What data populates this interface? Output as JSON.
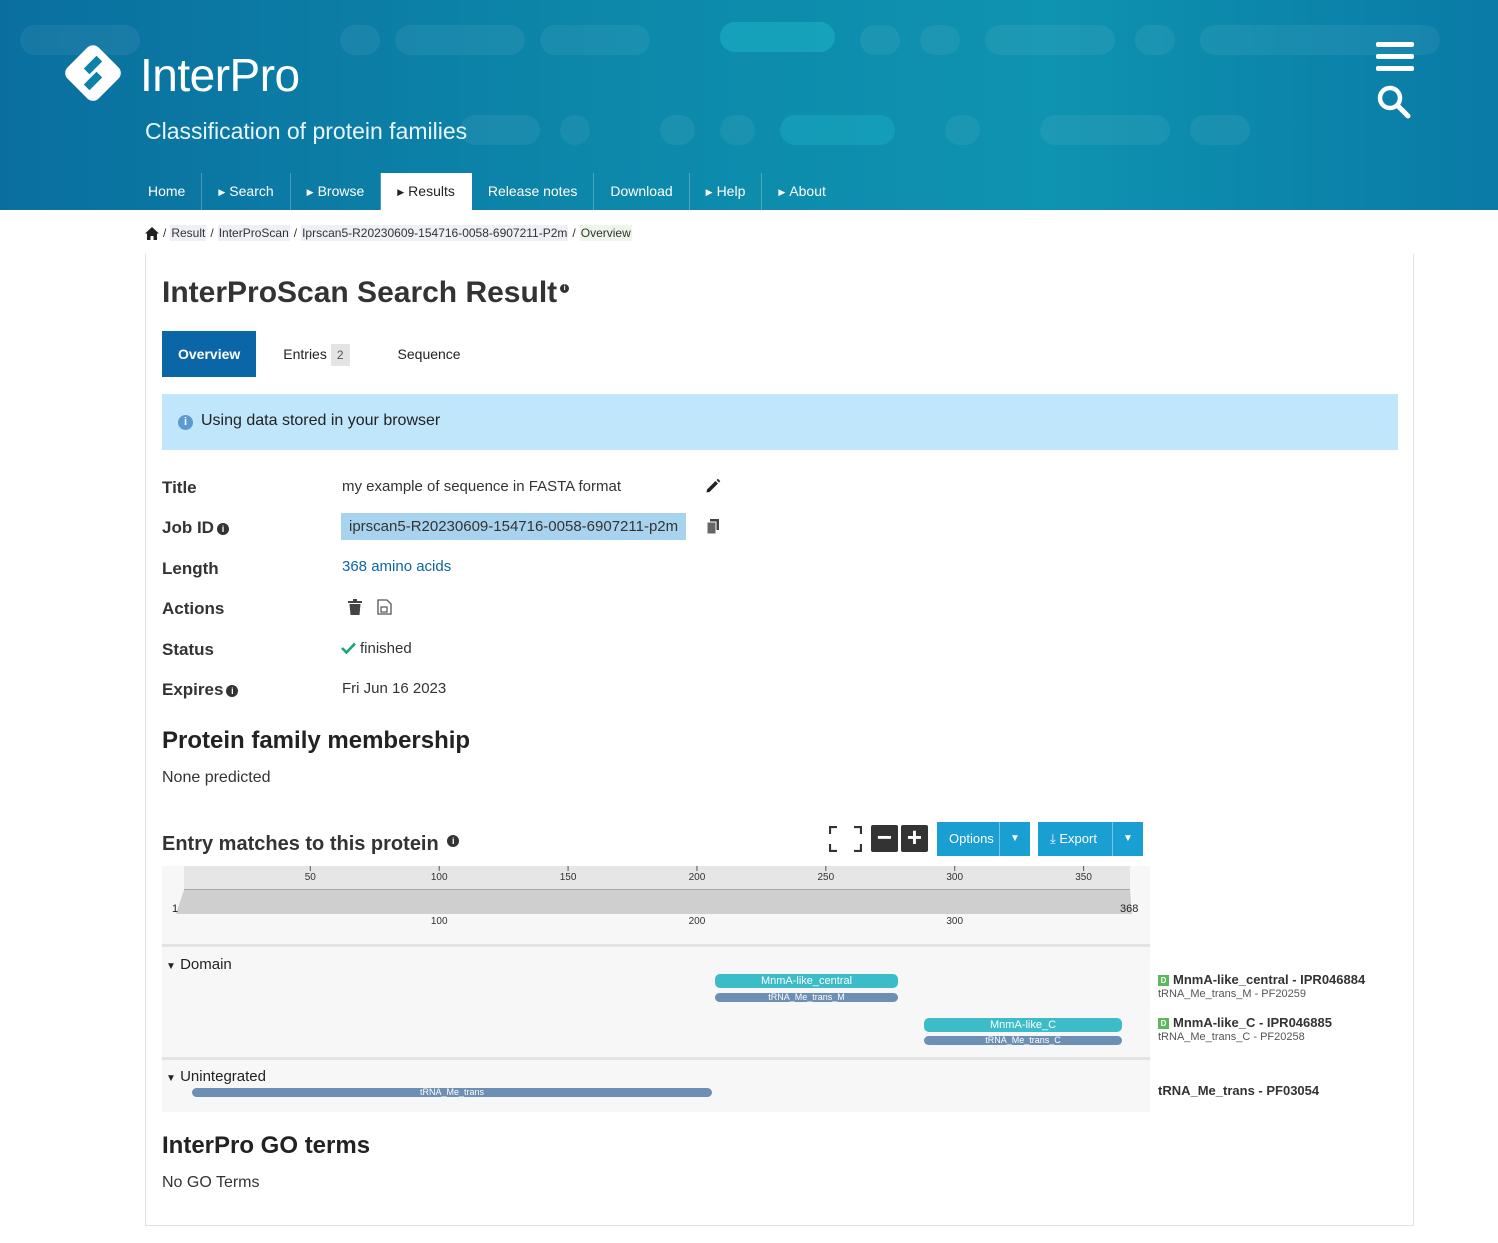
{
  "header": {
    "logo_text": "InterPro",
    "tagline": "Classification of protein families",
    "nav": [
      {
        "label": "Home",
        "caret": false,
        "active": false
      },
      {
        "label": "Search",
        "caret": true,
        "active": false
      },
      {
        "label": "Browse",
        "caret": true,
        "active": false
      },
      {
        "label": "Results",
        "caret": true,
        "active": true
      },
      {
        "label": "Release notes",
        "caret": false,
        "active": false
      },
      {
        "label": "Download",
        "caret": false,
        "active": false
      },
      {
        "label": "Help",
        "caret": true,
        "active": false
      },
      {
        "label": "About",
        "caret": true,
        "active": false
      }
    ]
  },
  "breadcrumb": {
    "sep": "/",
    "items": [
      "Result",
      "InterProScan",
      "Iprscan5-R20230609-154716-0058-6907211-P2m",
      "Overview"
    ]
  },
  "page": {
    "title": "InterProScan Search Result",
    "title_info": "i",
    "tabs": [
      {
        "label": "Overview",
        "badge": ""
      },
      {
        "label": "Entries",
        "badge": "2"
      },
      {
        "label": "Sequence",
        "badge": ""
      }
    ],
    "callout": "Using data stored in your browser"
  },
  "details": {
    "title_label": "Title",
    "title_value": "my example of sequence in FASTA format",
    "jobid_label": "Job ID",
    "jobid_value": "iprscan5-R20230609-154716-0058-6907211-p2m",
    "length_label": "Length",
    "length_value": "368 amino acids",
    "actions_label": "Actions",
    "status_label": "Status",
    "status_value": "finished",
    "expires_label": "Expires",
    "expires_value": "Fri Jun 16 2023"
  },
  "family": {
    "heading": "Protein family membership",
    "text": "None predicted"
  },
  "matches": {
    "heading": "Entry matches to this protein",
    "options_label": "Options",
    "export_label": "Export",
    "protein_length": 368,
    "top_ticks": [
      "50",
      "100",
      "150",
      "200",
      "250",
      "300",
      "350"
    ],
    "bottom_ticks": [
      "100",
      "200",
      "300"
    ],
    "start_label": "1",
    "end_label": "368",
    "domain_label": "Domain",
    "unintegrated_label": "Unintegrated",
    "features": [
      {
        "name": "MnmA-like_central",
        "start": 207,
        "end": 278,
        "kind": "dom",
        "row": 0
      },
      {
        "name": "tRNA_Me_trans_M",
        "start": 207,
        "end": 278,
        "kind": "pf",
        "row": 1
      },
      {
        "name": "MnmA-like_C",
        "start": 288,
        "end": 365,
        "kind": "dom",
        "row": 2
      },
      {
        "name": "tRNA_Me_trans_C",
        "start": 288,
        "end": 365,
        "kind": "pf",
        "row": 3
      },
      {
        "name": "tRNA_Me_trans",
        "start": 4,
        "end": 206,
        "kind": "pf",
        "row": 4
      }
    ],
    "legend": [
      {
        "badge": "D",
        "title": "MnmA-like_central - IPR046884",
        "sub": "tRNA_Me_trans_M - PF20259"
      },
      {
        "badge": "D",
        "title": "MnmA-like_C - IPR046885",
        "sub": "tRNA_Me_trans_C - PF20258"
      },
      {
        "badge": "",
        "title": "tRNA_Me_trans - PF03054",
        "sub": ""
      }
    ]
  },
  "go": {
    "heading": "InterPro GO terms",
    "text": "No GO Terms"
  }
}
